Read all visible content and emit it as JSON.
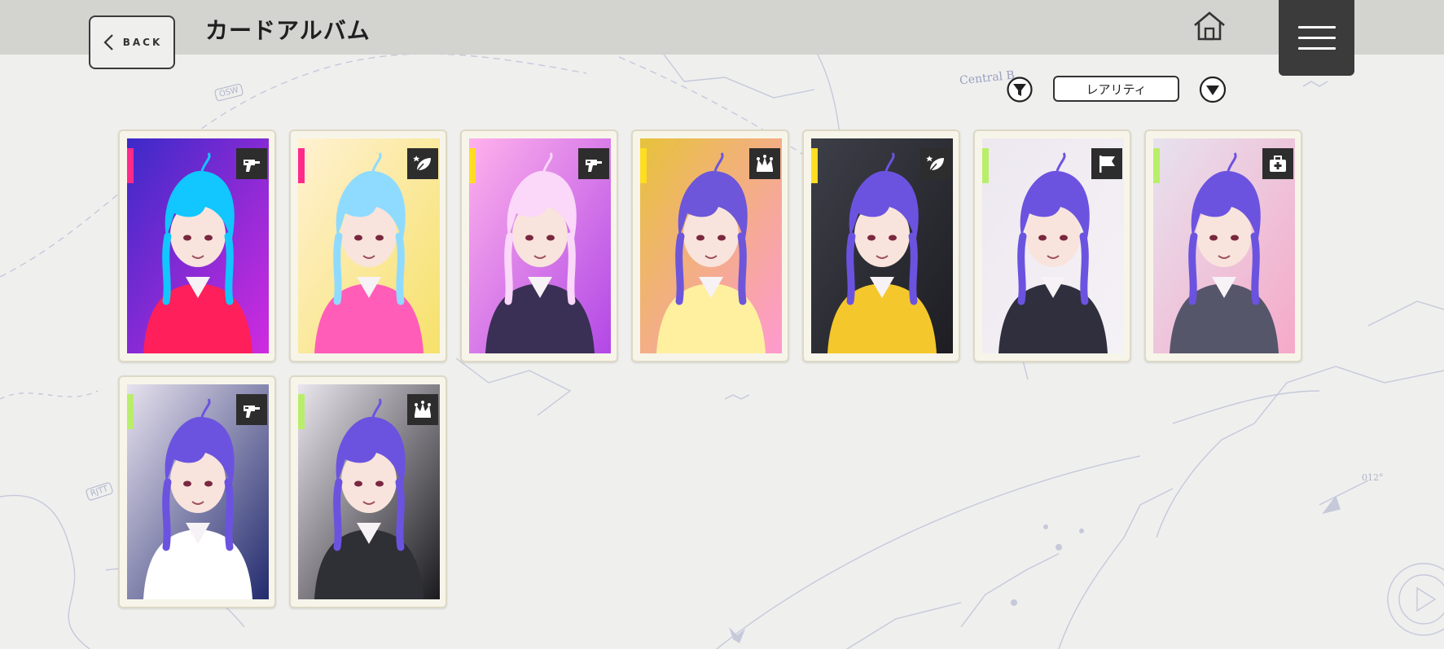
{
  "header": {
    "back_label": "BACK",
    "title": "カードアルバム"
  },
  "sort": {
    "selected": "レアリティ"
  },
  "background": {
    "map_labels": [
      "Central B",
      "OSW",
      "RJTT",
      "012°"
    ]
  },
  "cards": [
    {
      "type_icon": "drill-icon",
      "rarity_color": "#ff2a8a",
      "palette": [
        "#3b2ac8",
        "#d02be0",
        "#ff1f5a",
        "#12c6ff"
      ]
    },
    {
      "type_icon": "leaf-icon",
      "rarity_color": "#ff2a8a",
      "palette": [
        "#fff1d2",
        "#f6e16a",
        "#ff5db8",
        "#8fdbff"
      ]
    },
    {
      "type_icon": "drill-icon",
      "rarity_color": "#ffdd22",
      "palette": [
        "#ffb1ec",
        "#b248e6",
        "#3a2f55",
        "#fbd7fa"
      ]
    },
    {
      "type_icon": "jester-icon",
      "rarity_color": "#ffdd22",
      "palette": [
        "#e7c23a",
        "#ff9ad0",
        "#fff0a0",
        "#6d56d9"
      ]
    },
    {
      "type_icon": "leaf-icon",
      "rarity_color": "#ffdd22",
      "palette": [
        "#3d3f48",
        "#1d1d22",
        "#f4c82c",
        "#6b53e0"
      ]
    },
    {
      "type_icon": "flag-icon",
      "rarity_color": "#b8ee6a",
      "palette": [
        "#ede8f0",
        "#f5f2f6",
        "#2f2f3d",
        "#6b53e0"
      ]
    },
    {
      "type_icon": "medkit-icon",
      "rarity_color": "#b8ee6a",
      "palette": [
        "#e7e2ee",
        "#f5a9c8",
        "#56566a",
        "#6b53e0"
      ]
    },
    {
      "type_icon": "drill-icon",
      "rarity_color": "#b8ee6a",
      "palette": [
        "#e7e2ee",
        "#232b6e",
        "#ffffff",
        "#6b53e0"
      ]
    },
    {
      "type_icon": "jester-icon",
      "rarity_color": "#b8ee6a",
      "palette": [
        "#eae6ee",
        "#1b1b1f",
        "#2f2f36",
        "#6b53e0"
      ]
    }
  ]
}
